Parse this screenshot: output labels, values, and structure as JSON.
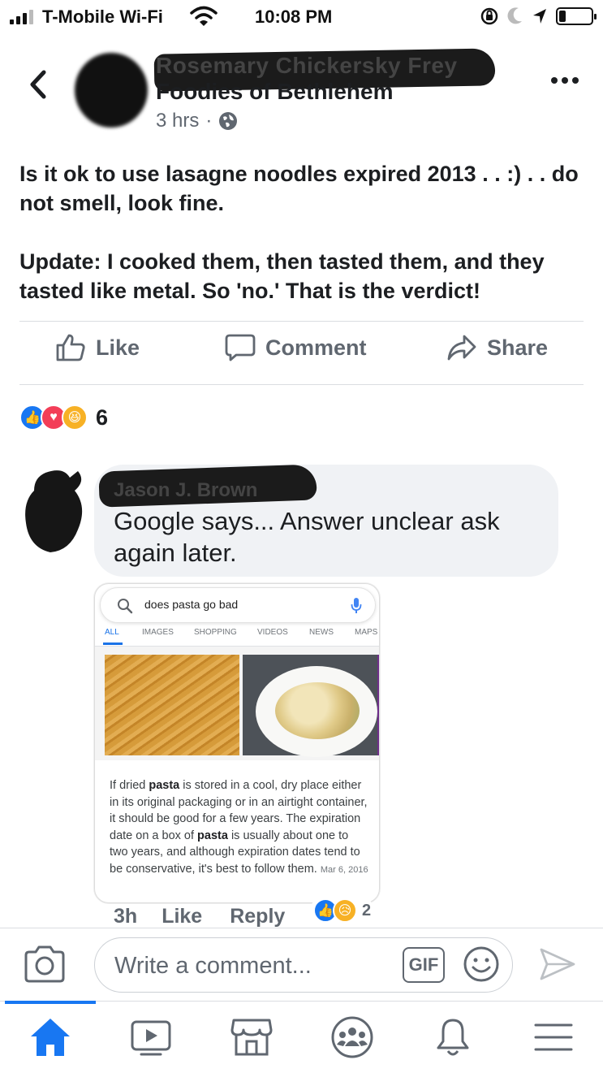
{
  "status_bar": {
    "carrier": "T-Mobile Wi-Fi",
    "time": "10:08 PM"
  },
  "post": {
    "author": "Rosemary Chickersky Frey",
    "group": "Foodies of Bethlehem",
    "time_ago": "3 hrs",
    "text_line1": "Is it ok to use lasagne noodles expired 2013 . . :) . . do not smell, look fine.",
    "text_line2": "Update: I cooked them, then tasted them, and they tasted like metal. So 'no.' That is the verdict!",
    "actions": {
      "like": "Like",
      "comment": "Comment",
      "share": "Share"
    },
    "reaction_count": "6"
  },
  "comment": {
    "author": "Jason J. Brown",
    "text": "Google says... Answer unclear ask again later.",
    "time": "3h",
    "like_label": "Like",
    "reply_label": "Reply",
    "reaction_count": "2",
    "attachment": {
      "query": "does pasta go bad",
      "tabs": [
        "ALL",
        "IMAGES",
        "SHOPPING",
        "VIDEOS",
        "NEWS",
        "MAPS"
      ],
      "snippet_parts": {
        "p1": "If dried ",
        "b1": "pasta",
        "p2": " is stored in a cool, dry place either in its original packaging or in an airtight container, it should be good for a few years. The expiration date on a box of ",
        "b2": "pasta",
        "p3": " is usually about one to two years, and although expiration dates tend to be conservative, it's best to follow them. ",
        "date": "Mar 6, 2016"
      }
    }
  },
  "composer": {
    "placeholder": "Write a comment...",
    "gif_label": "GIF"
  },
  "colors": {
    "facebook_blue": "#1877f2",
    "text_primary": "#1c1e21",
    "text_secondary": "#606770",
    "bubble_bg": "#f0f2f5"
  }
}
